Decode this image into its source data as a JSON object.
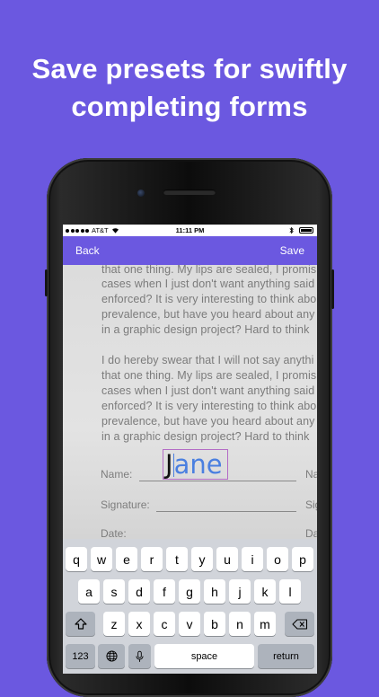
{
  "headline": {
    "line1": "Save presets for swiftly",
    "line2": "completing forms"
  },
  "statusbar": {
    "carrier": "AT&T",
    "time": "11:11 PM",
    "icons": [
      "signal-dots-icon",
      "wifi-icon",
      "bluetooth-icon",
      "battery-icon"
    ]
  },
  "navbar": {
    "back_label": "Back",
    "save_label": "Save",
    "color": "#6b58e0"
  },
  "document": {
    "lines": [
      "that one thing. My lips are sealed, I promis",
      "cases when I just don't want anything said",
      "enforced? It is very interesting to think abo",
      "prevalence, but have you heard about any",
      "in a graphic design project? Hard to think",
      "I do hereby swear that I will not say anythi",
      "that one thing. My lips are sealed, I promis",
      "cases when I just don't want anything said",
      "enforced? It is very interesting to think abo",
      "prevalence, but have you heard about any",
      "in a graphic design project? Hard to think"
    ],
    "name_label": "Name:",
    "name_right": "Na",
    "signature_label": "Signature:",
    "signature_right": "Sig",
    "date_label": "Date:",
    "date_right": "Da",
    "input_typed": "J",
    "input_suggestion": "ane"
  },
  "keyboard": {
    "row1": [
      "q",
      "w",
      "e",
      "r",
      "t",
      "y",
      "u",
      "i",
      "o",
      "p"
    ],
    "row2": [
      "a",
      "s",
      "d",
      "f",
      "g",
      "h",
      "j",
      "k",
      "l"
    ],
    "row3": [
      "z",
      "x",
      "c",
      "v",
      "b",
      "n",
      "m"
    ],
    "numbers_label": "123",
    "space_label": "space",
    "return_label": "return",
    "shift_icon": "shift-icon",
    "delete_icon": "delete-icon",
    "globe_icon": "globe-icon",
    "mic_icon": "microphone-icon"
  },
  "colors": {
    "background": "#6b58e0",
    "suggestion": "#4a7fe0",
    "input_border": "#b46cc6"
  }
}
